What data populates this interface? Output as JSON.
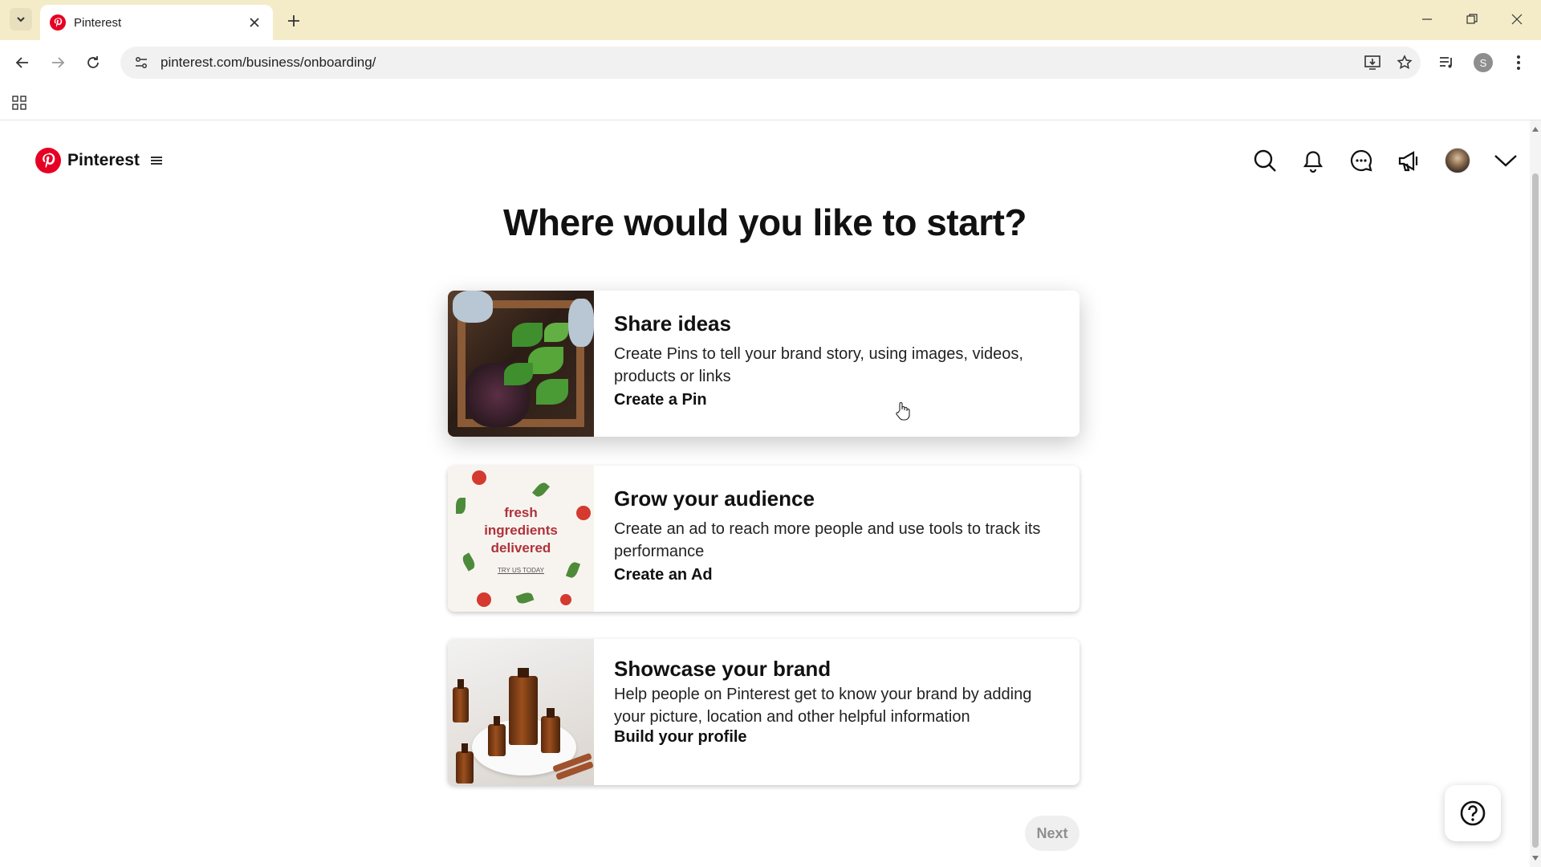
{
  "browser": {
    "tab_title": "Pinterest",
    "url": "pinterest.com/business/onboarding/",
    "profile_initial": "S"
  },
  "header": {
    "logo_text": "Pinterest"
  },
  "main": {
    "title": "Where would you like to start?",
    "cards": [
      {
        "title": "Share ideas",
        "description": "Create Pins to tell your brand story, using images, videos, products or links",
        "link": "Create a Pin"
      },
      {
        "title": "Grow your audience",
        "description": "Create an ad to reach more people and use tools to track its performance",
        "link": "Create an Ad",
        "image_text": [
          "fresh",
          "ingredients",
          "delivered"
        ],
        "image_small_text": "TRY US TODAY"
      },
      {
        "title": "Showcase your brand",
        "description": "Help people on Pinterest get to know your brand by adding your picture, location and other helpful information",
        "link": "Build your profile"
      }
    ],
    "next_label": "Next"
  },
  "colors": {
    "brand": "#e60023",
    "tabstrip": "#f4ecc9",
    "next_disabled_bg": "#efefef"
  },
  "icons": [
    "search-icon",
    "bell-icon",
    "chat-icon",
    "megaphone-icon",
    "avatar",
    "chevron-down-icon",
    "help-icon",
    "menu-icon"
  ]
}
